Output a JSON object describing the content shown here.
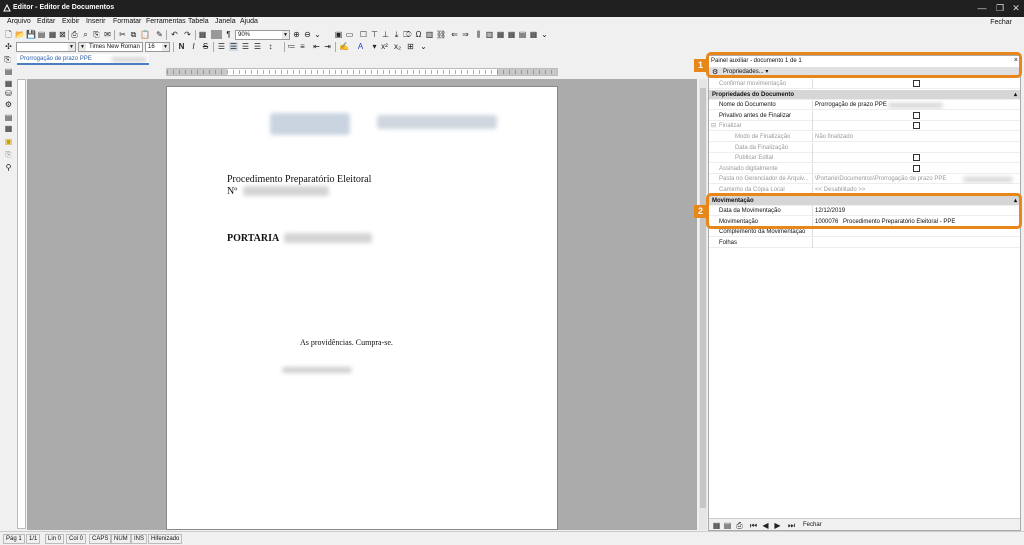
{
  "window": {
    "title": "Editor - Editor de Documentos",
    "fechar": "Fechar"
  },
  "menu": [
    "Arquivo",
    "Editar",
    "Exibir",
    "Inserir",
    "Formatar",
    "Ferramentas",
    "Tabela",
    "Janela",
    "Ajuda"
  ],
  "toolbar": {
    "zoom": "90%",
    "font_name": "Times New Roman",
    "font_size": "16",
    "bold": "N",
    "italic": "I",
    "strike": "S",
    "style_combo": ""
  },
  "tab": {
    "label": "Prorrogação de prazo PPE"
  },
  "document": {
    "heading": "Procedimento Preparatório Eleitoral",
    "number_label": "Nº",
    "portaria": "PORTARIA",
    "closing": "As providências. Cumpra-se."
  },
  "status": [
    "Pág 1",
    "1/1",
    "Lin 0",
    "Col 0",
    "CAPS",
    "NUM",
    "INS",
    "Hifenizado"
  ],
  "panel": {
    "title": "Painel auxiliar - documento 1 de 1",
    "close": "×",
    "props_label": "Propriedades...",
    "rows": [
      {
        "label": "Confirmar movimentação",
        "value": "",
        "type": "check",
        "disabled": true,
        "indent": 10
      },
      {
        "label": "Propriedades do Documento",
        "type": "section"
      },
      {
        "label": "Nome do Documento",
        "value": "Prorrogação de prazo PPE",
        "indent": 10
      },
      {
        "label": "Privativo antes de Finalizar",
        "value": "",
        "type": "check",
        "indent": 10
      },
      {
        "label": "Finalizar",
        "value": "",
        "type": "check",
        "disabled": true,
        "indent": 10,
        "expander": "⊟"
      },
      {
        "label": "Modo de Finalização",
        "value": "Não finalizado",
        "disabled": true,
        "indent": 26
      },
      {
        "label": "Data da Finalização",
        "value": "",
        "disabled": true,
        "indent": 26
      },
      {
        "label": "Publicar Edital",
        "value": "",
        "type": "check",
        "disabled": true,
        "indent": 26
      },
      {
        "label": "Assinado digitalmente",
        "value": "",
        "type": "check",
        "disabled": true,
        "indent": 10
      },
      {
        "label": "Pasta no Gerenciador de Arquiv...",
        "value": "\\Portarie\\Documentos\\Prorrogação de prazo PPE",
        "disabled": true,
        "indent": 10
      },
      {
        "label": "Caminho da Cópia Local",
        "value": "<< Desabilitado >>",
        "disabled": true,
        "indent": 10
      },
      {
        "label": "Movimentação",
        "type": "section"
      },
      {
        "label": "Data da Movimentação",
        "value": "12/12/2019",
        "indent": 10
      },
      {
        "label": "Movimentação",
        "value": "1000076",
        "extra": "Procedimento Preparatório Eleitoral - PPE",
        "indent": 10
      },
      {
        "label": "Complemento da Movimentação",
        "value": "",
        "indent": 10
      },
      {
        "label": "Folhas",
        "value": "",
        "indent": 10
      }
    ],
    "bottom_close": "Fechar"
  },
  "annotations": [
    "1",
    "2"
  ],
  "colors": {
    "highlight": "#e8861a",
    "tab_accent": "#2b5fa8",
    "canvas": "#ababab"
  }
}
